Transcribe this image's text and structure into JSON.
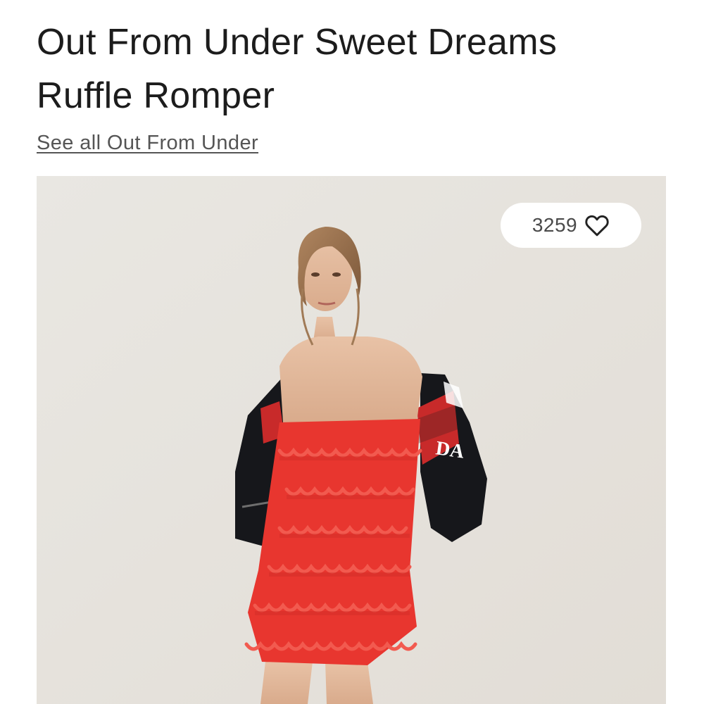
{
  "product": {
    "title_line1": "Out From Under Sweet Dreams",
    "title_line2": "Ruffle Romper",
    "brand_link": "See all Out From Under"
  },
  "image": {
    "like_count": "3259",
    "like_icon": "heart-outline-icon",
    "jacket_text": "DA"
  },
  "colors": {
    "romper": "#e8362f",
    "background": "#e7e4df",
    "jacket": "#15161a"
  }
}
